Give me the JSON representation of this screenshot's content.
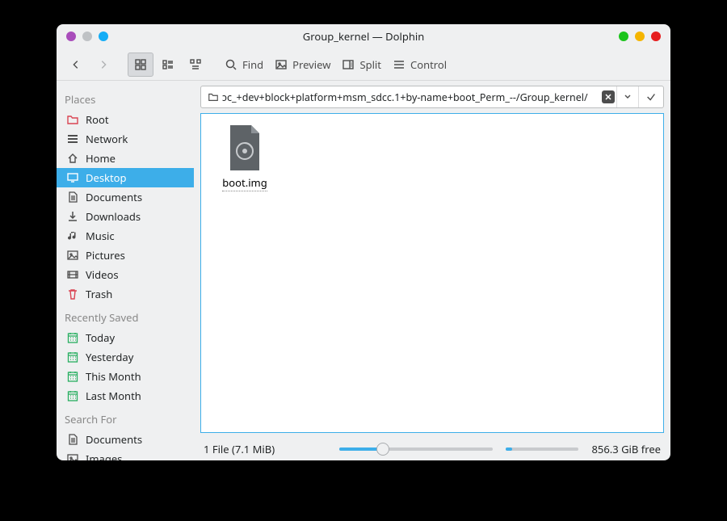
{
  "window": {
    "title": "Group_kernel — Dolphin"
  },
  "toolbar": {
    "find": "Find",
    "preview": "Preview",
    "split": "Split",
    "control": "Control"
  },
  "location": {
    "path": "ɔc_+dev+block+platform+msm_sdcc.1+by-name+boot_Perm_--/Group_kernel/"
  },
  "sidebar": {
    "sections": [
      {
        "title": "Places",
        "items": [
          {
            "icon": "folder-red",
            "label": "Root"
          },
          {
            "icon": "network",
            "label": "Network"
          },
          {
            "icon": "home",
            "label": "Home"
          },
          {
            "icon": "desktop",
            "label": "Desktop",
            "selected": true
          },
          {
            "icon": "document",
            "label": "Documents"
          },
          {
            "icon": "download",
            "label": "Downloads"
          },
          {
            "icon": "music",
            "label": "Music"
          },
          {
            "icon": "image",
            "label": "Pictures"
          },
          {
            "icon": "video",
            "label": "Videos"
          },
          {
            "icon": "trash",
            "label": "Trash"
          }
        ]
      },
      {
        "title": "Recently Saved",
        "items": [
          {
            "icon": "calendar",
            "label": "Today"
          },
          {
            "icon": "calendar",
            "label": "Yesterday"
          },
          {
            "icon": "calendar",
            "label": "This Month"
          },
          {
            "icon": "calendar",
            "label": "Last Month"
          }
        ]
      },
      {
        "title": "Search For",
        "items": [
          {
            "icon": "document",
            "label": "Documents"
          },
          {
            "icon": "image",
            "label": "Images"
          }
        ]
      }
    ]
  },
  "files": [
    {
      "name": "boot.img",
      "type": "cd-image"
    }
  ],
  "status": {
    "summary": "1 File (7.1 MiB)",
    "zoom_percent": 28,
    "disk_used_percent": 8,
    "disk_free": "856.3 GiB free"
  }
}
